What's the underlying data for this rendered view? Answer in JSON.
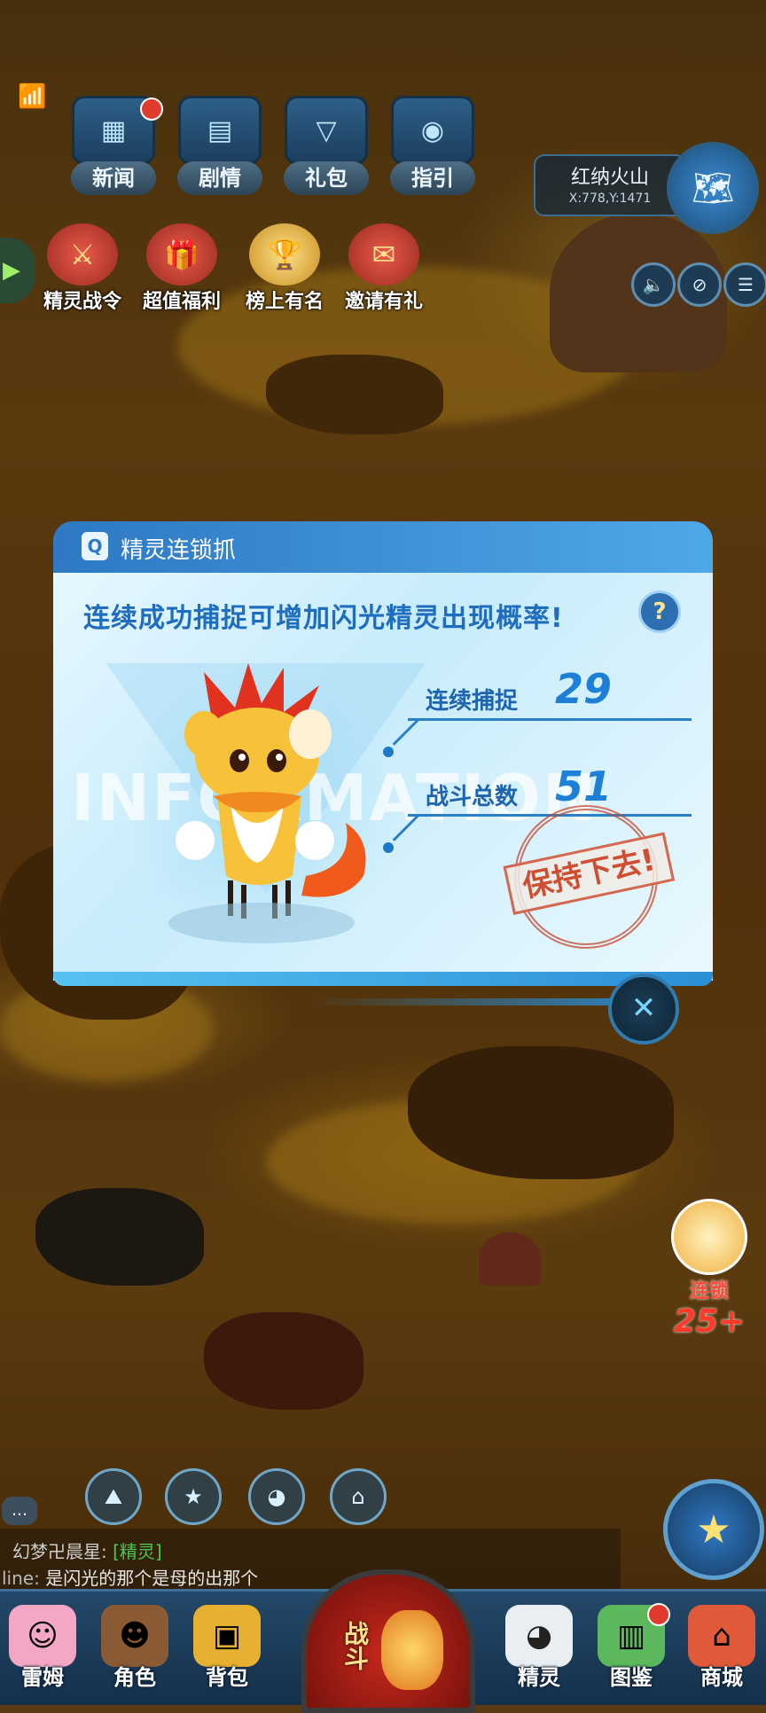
{
  "hud": {
    "top_buttons": [
      {
        "label": "新闻",
        "icon": "news-icon",
        "badge": true
      },
      {
        "label": "剧情",
        "icon": "story-icon",
        "badge": false
      },
      {
        "label": "礼包",
        "icon": "gift-pack-icon",
        "badge": false
      },
      {
        "label": "指引",
        "icon": "guide-icon",
        "badge": false
      }
    ],
    "location": {
      "name": "红纳火山",
      "coords": "X:778,Y:1471"
    },
    "features": [
      {
        "label": "精灵战令",
        "icon": "battle-pass-icon"
      },
      {
        "label": "超值福利",
        "icon": "welfare-icon"
      },
      {
        "label": "榜上有名",
        "icon": "ranking-icon"
      },
      {
        "label": "邀请有礼",
        "icon": "invite-icon"
      }
    ]
  },
  "dialog": {
    "title": "精灵连锁抓",
    "subtitle": "连续成功捕捉可增加闪光精灵出现概率!",
    "help": "?",
    "watermark": "INFORMATION",
    "stats": [
      {
        "label": "连续捕捉",
        "value": "29"
      },
      {
        "label": "战斗总数",
        "value": "51"
      }
    ],
    "stamp": "保持下去!",
    "close_icon": "close-icon"
  },
  "combo": {
    "label": "连锁",
    "value": "25+"
  },
  "chat": {
    "line1_user": "幻梦卍晨星:",
    "line1_tag": "[精灵]",
    "line2_user": "line:",
    "line2_text": "是闪光的那个是母的出那个"
  },
  "nav": {
    "items_left": [
      {
        "label": "雷姆",
        "icon": "rem-icon"
      },
      {
        "label": "角色",
        "icon": "character-icon"
      },
      {
        "label": "背包",
        "icon": "backpack-icon"
      }
    ],
    "battle": "战斗",
    "items_right": [
      {
        "label": "精灵",
        "icon": "spirit-icon"
      },
      {
        "label": "图鉴",
        "icon": "codex-icon",
        "badge": true
      },
      {
        "label": "商城",
        "icon": "shop-icon"
      }
    ]
  },
  "colors": {
    "accent": "#1f6dbf",
    "dialog_header": "#2e78c4",
    "stamp": "#cd4628"
  }
}
